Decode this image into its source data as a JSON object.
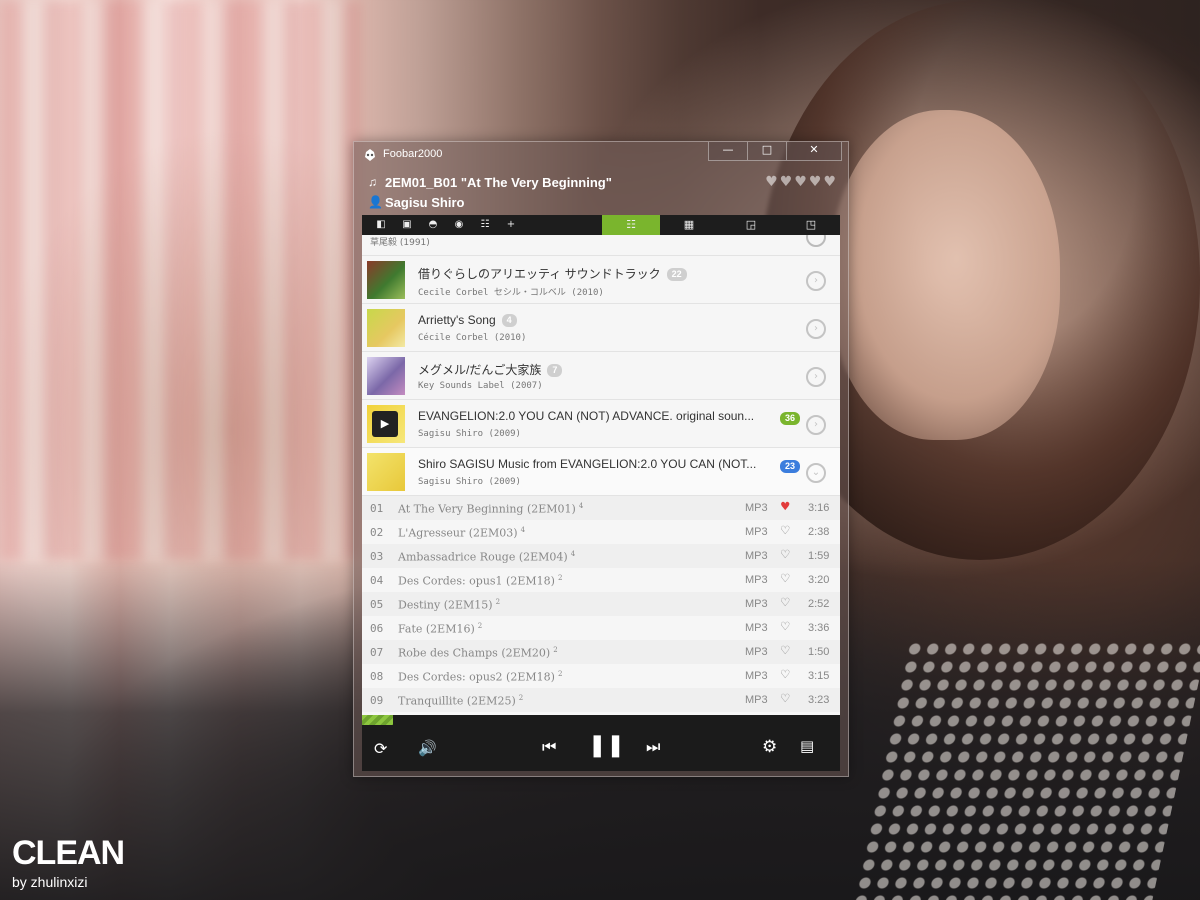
{
  "window": {
    "title": "Foobar2000",
    "min_label": "—",
    "max_label": "□",
    "close_label": "✕"
  },
  "now_playing": {
    "track_line": "2EM01_B01 \"At The Very Beginning\"",
    "artist_line": "Sagisu Shiro",
    "rating_hearts": [
      "♥",
      "♥",
      "♥",
      "♥",
      "♥"
    ]
  },
  "toolbar": {
    "left_icons": [
      "◧",
      "▣",
      "◓",
      "◉",
      "☷",
      "+"
    ],
    "view_icons": [
      "☷",
      "▦",
      "◲",
      "◳"
    ],
    "active_view": 0
  },
  "list": {
    "truncated_album_sub": "草尾毅 (1991)",
    "albums": [
      {
        "title": "借りぐらしのアリエッティ サウンドトラック",
        "count": "22",
        "count_color": "gray",
        "sub": "Cecile Corbel セシル・コルベル (2010)"
      },
      {
        "title": "Arrietty's Song",
        "count": "4",
        "count_color": "gray",
        "sub": "Cécile Corbel (2010)"
      },
      {
        "title": "メグメル/だんご大家族",
        "count": "7",
        "count_color": "gray",
        "sub": "Key Sounds Label (2007)"
      },
      {
        "title": "EVANGELION:2.0 YOU CAN (NOT) ADVANCE. original soun...",
        "count": "36",
        "count_color": "green",
        "sub": "Sagisu Shiro (2009)",
        "playing": true
      },
      {
        "title": "Shiro SAGISU Music from EVANGELION:2.0 YOU CAN (NOT...",
        "count": "23",
        "count_color": "blue",
        "sub": "Sagisu Shiro (2009)",
        "expanded": true
      }
    ],
    "tracks": [
      {
        "num": "01",
        "title": "At The Very Beginning (2EM01)",
        "rating": "4",
        "format": "MP3",
        "loved": true,
        "duration": "3:16"
      },
      {
        "num": "02",
        "title": "L'Agresseur (2EM03)",
        "rating": "4",
        "format": "MP3",
        "loved": false,
        "duration": "2:38"
      },
      {
        "num": "03",
        "title": "Ambassadrice Rouge (2EM04)",
        "rating": "4",
        "format": "MP3",
        "loved": false,
        "duration": "1:59"
      },
      {
        "num": "04",
        "title": "Des Cordes: opus1 (2EM18)",
        "rating": "2",
        "format": "MP3",
        "loved": false,
        "duration": "3:20"
      },
      {
        "num": "05",
        "title": "Destiny (2EM15)",
        "rating": "2",
        "format": "MP3",
        "loved": false,
        "duration": "2:52"
      },
      {
        "num": "06",
        "title": "Fate (2EM16)",
        "rating": "2",
        "format": "MP3",
        "loved": false,
        "duration": "3:36"
      },
      {
        "num": "07",
        "title": "Robe des Champs (2EM20)",
        "rating": "2",
        "format": "MP3",
        "loved": false,
        "duration": "1:50"
      },
      {
        "num": "08",
        "title": "Des Cordes: opus2 (2EM18)",
        "rating": "2",
        "format": "MP3",
        "loved": false,
        "duration": "3:15"
      },
      {
        "num": "09",
        "title": "Tranquillite (2EM25)",
        "rating": "2",
        "format": "MP3",
        "loved": false,
        "duration": "3:23"
      }
    ]
  },
  "playback": {
    "progress_fraction": 0.065,
    "repeat_icon": "⟳",
    "volume_icon": "🔊",
    "prev_icon": "⏮",
    "pause_icon": "❚❚",
    "next_icon": "⏭",
    "settings_icon": "⚙",
    "panel_icon": "▤"
  },
  "brand": {
    "name": "CLEAN",
    "author": "by zhulinxizi"
  },
  "colors": {
    "accent_green": "#7ab52d",
    "count_blue": "#3b7ddd",
    "loved_red": "#e23b3b"
  }
}
